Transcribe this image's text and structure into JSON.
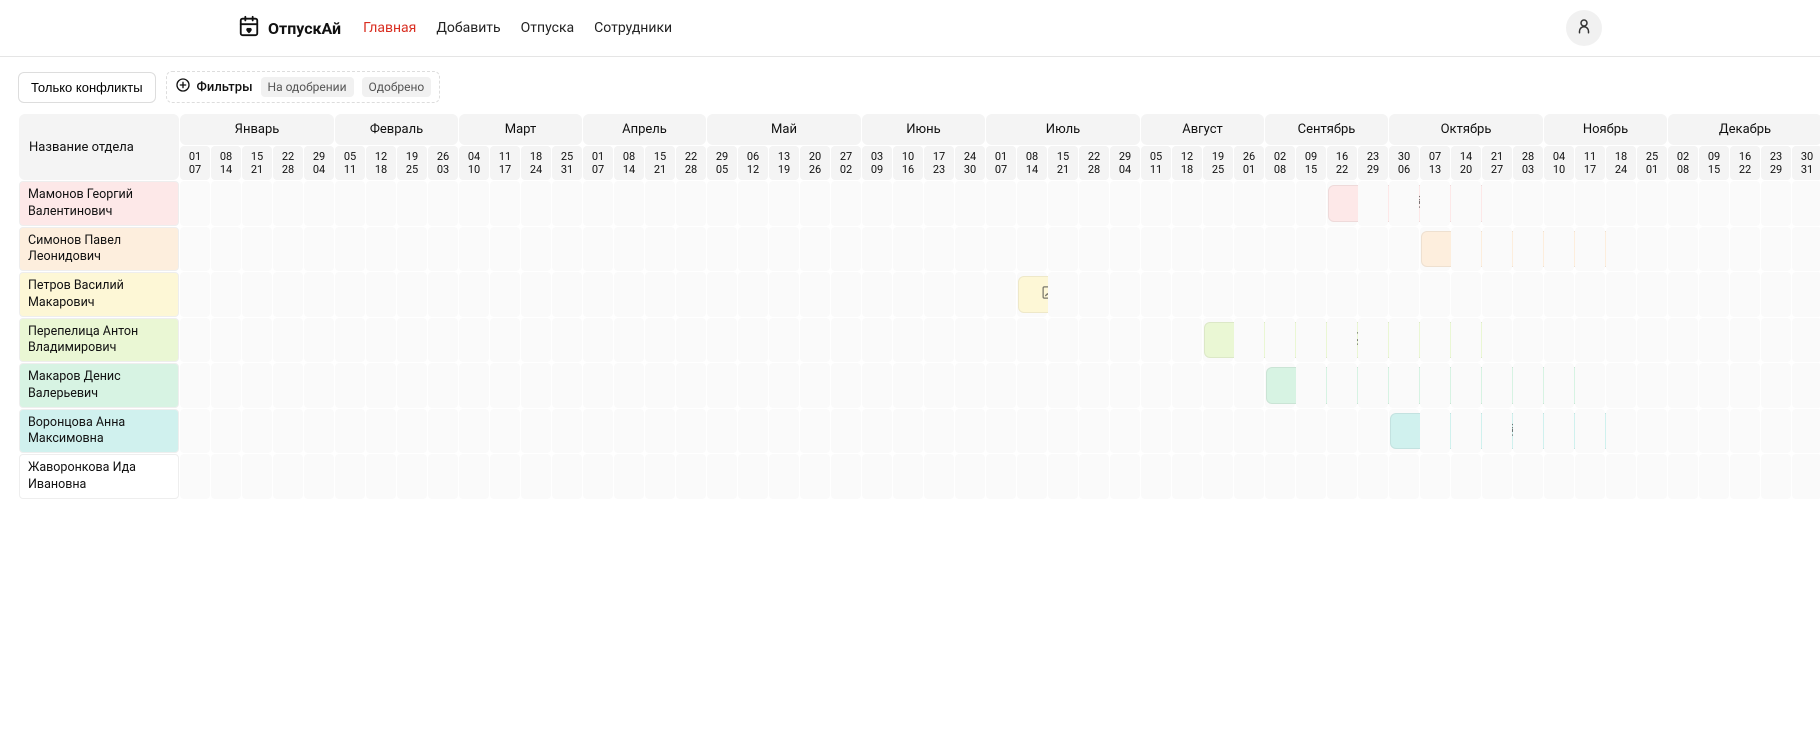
{
  "brand": "ОтпускАй",
  "nav": {
    "home": "Главная",
    "add": "Добавить",
    "vacations": "Отпуска",
    "employees": "Сотрудники"
  },
  "toolbar": {
    "only_conflicts": "Только конфликты",
    "filters_label": "Фильтры",
    "tag_pending": "На одобрении",
    "tag_approved": "Одобрено"
  },
  "side_header": "Название отдела",
  "months": [
    "Январь",
    "Февраль",
    "Март",
    "Апрель",
    "Май",
    "Июнь",
    "Июль",
    "Август",
    "Сентябрь",
    "Октябрь",
    "Ноябрь",
    "Декабрь"
  ],
  "month_spans": [
    5,
    4,
    4,
    4,
    5,
    4,
    5,
    4,
    4,
    5,
    4,
    5
  ],
  "weeks": [
    "01\n07",
    "08\n14",
    "15\n21",
    "22\n28",
    "29\n04",
    "05\n11",
    "12\n18",
    "19\n25",
    "26\n03",
    "04\n10",
    "11\n17",
    "18\n24",
    "25\n31",
    "01\n07",
    "08\n14",
    "15\n21",
    "22\n28",
    "29\n05",
    "06\n12",
    "13\n19",
    "20\n26",
    "27\n02",
    "03\n09",
    "10\n16",
    "17\n23",
    "24\n30",
    "01\n07",
    "08\n14",
    "15\n21",
    "22\n28",
    "29\n04",
    "05\n11",
    "12\n18",
    "19\n25",
    "26\n01",
    "02\n08",
    "09\n15",
    "16\n22",
    "23\n29",
    "30\n06",
    "07\n13",
    "14\n20",
    "21\n27",
    "28\n03",
    "04\n10",
    "11\n17",
    "18\n24",
    "25\n01",
    "02\n08",
    "09\n15",
    "16\n22",
    "23\n29",
    "30\n31"
  ],
  "employees": [
    {
      "name": "Мамонов Георгий Валентинович",
      "color": 0
    },
    {
      "name": "Симонов Павел Леонидович",
      "color": 1
    },
    {
      "name": "Петров Василий Макарович",
      "color": 2
    },
    {
      "name": "Перепелица Антон Владимирович",
      "color": 3
    },
    {
      "name": "Макаров Денис Валерьевич",
      "color": 4
    },
    {
      "name": "Воронцова Анна Максимовна",
      "color": 5
    },
    {
      "name": "Жаворонкова Ида Ивановна",
      "color": 6
    }
  ],
  "chart_data": {
    "type": "bar",
    "title": "",
    "xlabel": "",
    "ylabel": "Название отдела",
    "categories": [
      "Мамонов Георгий Валентинович",
      "Симонов Павел Леонидович",
      "Петров Василий Макарович",
      "Перепелица Антон Владимирович",
      "Макаров Денис Валерьевич",
      "Воронцова Анна Максимовна",
      "Жаворонкова Ида Ивановна"
    ],
    "bars": [
      {
        "row": 0,
        "start": 37,
        "span": 6,
        "color": 0,
        "icon": "lock",
        "status": "Одобрено"
      },
      {
        "row": 1,
        "start": 40,
        "span": 7,
        "color": 1,
        "icon": "lock",
        "status": "Одобрено"
      },
      {
        "row": 2,
        "start": 27,
        "span": 2,
        "color": 2,
        "icon": "file",
        "status": "На одобрении"
      },
      {
        "row": 3,
        "start": 33,
        "span": 10,
        "color": 3,
        "icon": "file",
        "status": "На одобрении"
      },
      {
        "row": 4,
        "start": 35,
        "span": 11,
        "color": 4,
        "icon": "lock",
        "status": "Одобрено"
      },
      {
        "row": 5,
        "start": 39,
        "span": 8,
        "color": 5,
        "icon": "lock",
        "status": "Одобрено"
      }
    ]
  }
}
